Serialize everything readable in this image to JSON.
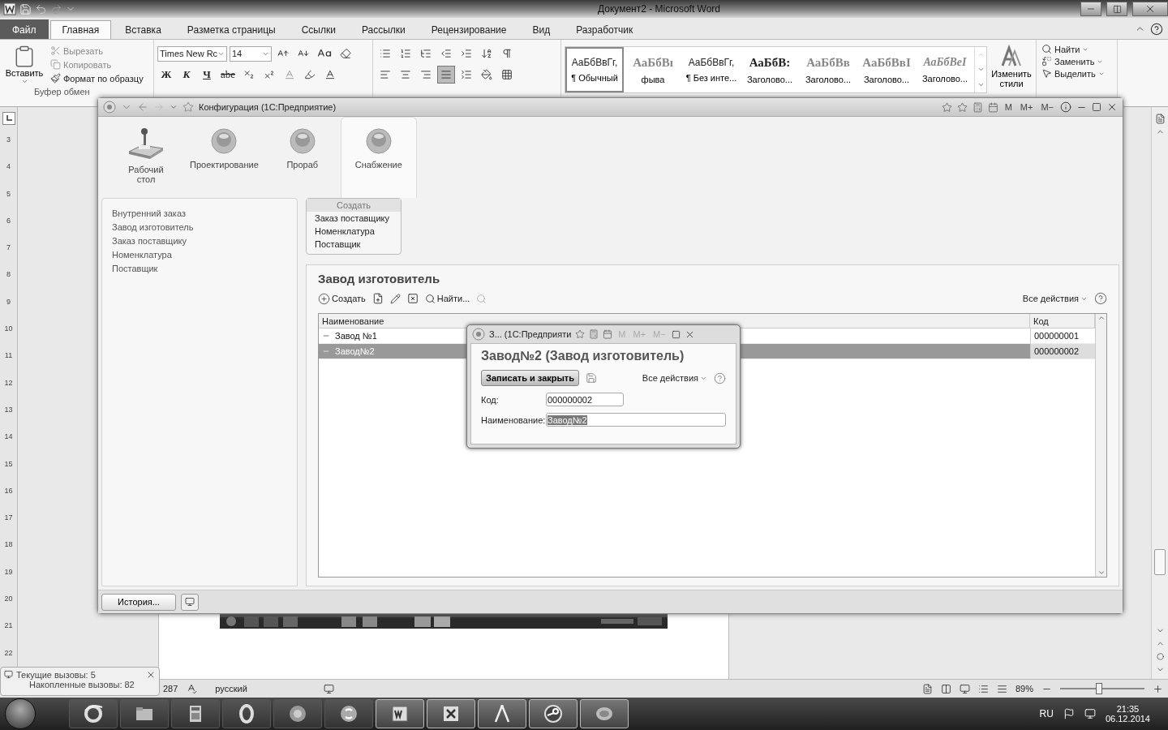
{
  "word": {
    "title": "Документ2  -  Microsoft Word",
    "tabs": [
      {
        "label": "Файл",
        "kind": "file",
        "selected": false
      },
      {
        "label": "Главная",
        "kind": "tab",
        "selected": true
      },
      {
        "label": "Вставка",
        "kind": "tab",
        "selected": false
      },
      {
        "label": "Разметка страницы",
        "kind": "tab",
        "selected": false
      },
      {
        "label": "Ссылки",
        "kind": "tab",
        "selected": false
      },
      {
        "label": "Рассылки",
        "kind": "tab",
        "selected": false
      },
      {
        "label": "Рецензирование",
        "kind": "tab",
        "selected": false
      },
      {
        "label": "Вид",
        "kind": "tab",
        "selected": false
      },
      {
        "label": "Разработчик",
        "kind": "tab",
        "selected": false
      }
    ],
    "clipboard": {
      "paste": "Вставить",
      "cut": "Вырезать",
      "copy": "Копировать",
      "format_painter": "Формат по образцу",
      "group": "Буфер обмен"
    },
    "font": {
      "name": "Times New Rc",
      "size": "14"
    },
    "format_buttons": [
      {
        "label": "Ж",
        "kind": "bold"
      },
      {
        "label": "К",
        "kind": "italic"
      },
      {
        "label": "Ч",
        "kind": "underline"
      },
      {
        "label": "abe",
        "kind": "strike"
      }
    ],
    "alignments": [
      {
        "kind": "left",
        "selected": false
      },
      {
        "kind": "center",
        "selected": false
      },
      {
        "kind": "right",
        "selected": false
      },
      {
        "kind": "justify",
        "selected": true
      }
    ],
    "styles": [
      {
        "sample": "АаБбВвГг,",
        "label": "¶ Обычный",
        "kind": "normal",
        "selected": true
      },
      {
        "sample": "АаБбВı",
        "label": "фыва",
        "kind": "big",
        "selected": false
      },
      {
        "sample": "АаБбВвГг,",
        "label": "¶ Без инте...",
        "kind": "normal",
        "selected": false
      },
      {
        "sample": "АаБбВ:",
        "label": "Заголово...",
        "kind": "heading",
        "selected": false
      },
      {
        "sample": "АаБбВв",
        "label": "Заголово...",
        "kind": "heading2",
        "selected": false
      },
      {
        "sample": "АаБбВвI",
        "label": "Заголово...",
        "kind": "heading2",
        "selected": false
      },
      {
        "sample": "АаБбВеI",
        "label": "Заголово...",
        "kind": "italic",
        "selected": false
      }
    ],
    "change_styles": "Изменить стили",
    "editing": [
      {
        "label": "Найти",
        "kind": "find"
      },
      {
        "label": "Заменить",
        "kind": "replace"
      },
      {
        "label": "Выделить",
        "kind": "select"
      }
    ],
    "ruler": [
      "3",
      "4",
      "5",
      "6",
      "7",
      "8",
      "9",
      "10",
      "11",
      "12",
      "13",
      "14",
      "15",
      "16",
      "17",
      "18",
      "19",
      "20",
      "21",
      "22"
    ],
    "status": {
      "words": "287",
      "language": "русский",
      "zoom": "89%",
      "zoom_slider": {
        "level": 0.45
      }
    }
  },
  "onec": {
    "title": "Конфигурация  (1С:Предприятие)",
    "memory": [
      "M",
      "M+",
      "M−"
    ],
    "sections": [
      {
        "label": "Рабочий стол",
        "kind": "desk",
        "selected": false
      },
      {
        "label": "Проектирование",
        "kind": "orb",
        "selected": false
      },
      {
        "label": "Прораб",
        "kind": "orb",
        "selected": false
      },
      {
        "label": "Снабжение",
        "kind": "orb",
        "selected": true
      }
    ],
    "navigation": [
      "Внутренний заказ",
      "Завод изготовитель",
      "Заказ поставщику",
      "Номенклатура",
      "Поставщик"
    ],
    "create_menu": {
      "title": "Создать",
      "items": [
        "Заказ поставщику",
        "Номенклатура",
        "Поставщик"
      ]
    },
    "list": {
      "title": "Завод изготовитель",
      "create": "Создать",
      "find": "Найти...",
      "all_actions": "Все действия",
      "columns": [
        "Наименование",
        "Код"
      ],
      "rows": [
        {
          "name": "Завод №1",
          "code": "000000001",
          "selected": false
        },
        {
          "name": "Завод№2",
          "code": "000000002",
          "selected": true
        }
      ]
    },
    "history": "История..."
  },
  "dialog": {
    "title": "З...  (1С:Предприяти",
    "memory": [
      "M",
      "M+",
      "M−"
    ],
    "heading": "Завод№2 (Завод изготовитель)",
    "save_close": "Записать и закрыть",
    "all_actions": "Все действия",
    "fields": [
      {
        "label": "Код:",
        "value": "000000002",
        "selected": false
      },
      {
        "label": "Наименование:",
        "value": "Завод№2",
        "selected": true
      }
    ]
  },
  "notification": {
    "lines": [
      "Текущие вызовы: 5",
      "Накопленные вызовы: 82"
    ]
  },
  "taskbar": {
    "apps": [
      {
        "kind": "ie",
        "active": false
      },
      {
        "kind": "explorer",
        "active": false
      },
      {
        "kind": "calculator",
        "active": false
      },
      {
        "kind": "opera",
        "active": false
      },
      {
        "kind": "disc",
        "active": false
      },
      {
        "kind": "skype",
        "active": false
      },
      {
        "kind": "word",
        "active": true
      },
      {
        "kind": "excel",
        "active": true
      },
      {
        "kind": "compass",
        "active": true
      },
      {
        "kind": "steam",
        "active": true
      },
      {
        "kind": "onec",
        "active": true
      }
    ],
    "language": "RU",
    "time": "21:35",
    "date": "06.12.2014"
  }
}
